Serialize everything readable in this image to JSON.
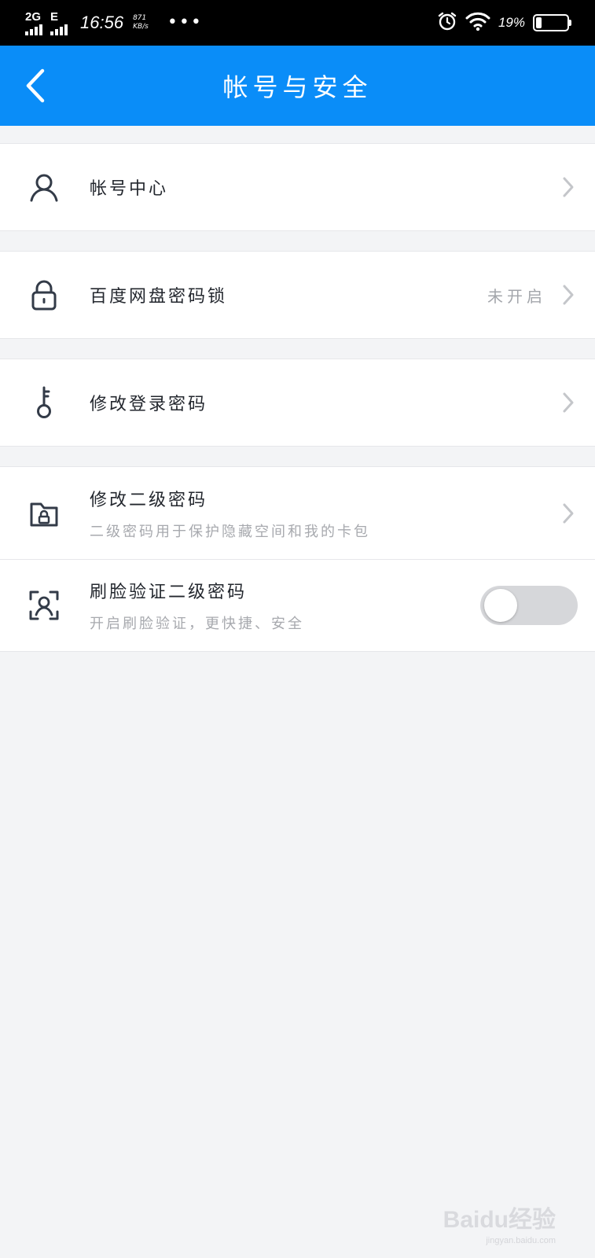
{
  "status_bar": {
    "network_1": "2G",
    "network_2": "E",
    "time": "16:56",
    "speed_value": "871",
    "speed_unit": "KB/s",
    "more": "•••",
    "battery_percent": "19%",
    "battery_level": 0.19
  },
  "header": {
    "title": "帐号与安全",
    "back_icon": "chevron-left-icon"
  },
  "items": [
    {
      "icon": "user-icon",
      "title": "帐号中心"
    },
    {
      "icon": "lock-icon",
      "title": "百度网盘密码锁",
      "value": "未开启"
    },
    {
      "icon": "key-icon",
      "title": "修改登录密码"
    },
    {
      "icon": "folder-lock-icon",
      "title": "修改二级密码",
      "subtitle": "二级密码用于保护隐藏空间和我的卡包"
    },
    {
      "icon": "face-scan-icon",
      "title": "刷脸验证二级密码",
      "subtitle": "开启刷脸验证，更快捷、安全",
      "toggle_on": false
    }
  ],
  "watermark": {
    "brand": "Baidu经验",
    "url": "jingyan.baidu.com"
  },
  "colors": {
    "primary": "#0a8df8",
    "background": "#f3f4f6",
    "text": "#23272e",
    "muted": "#a7a9ae"
  }
}
